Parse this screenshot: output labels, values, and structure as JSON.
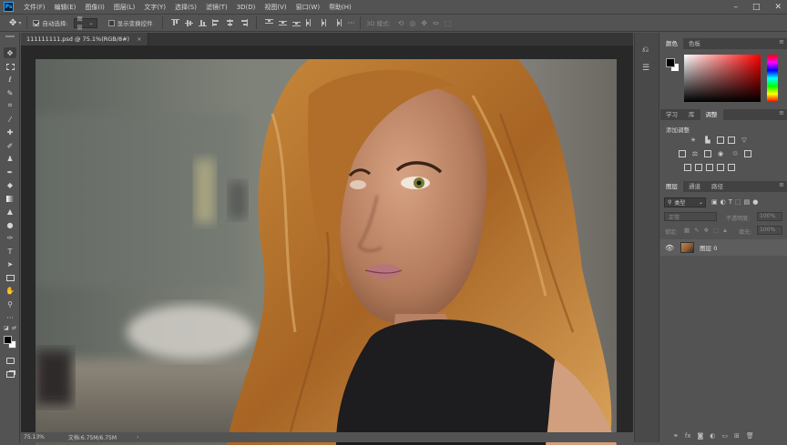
{
  "app": {
    "logo_text": "Ps"
  },
  "menubar": {
    "items": [
      "文件(F)",
      "编辑(E)",
      "图像(I)",
      "图层(L)",
      "文字(Y)",
      "选择(S)",
      "滤镜(T)",
      "3D(D)",
      "视图(V)",
      "窗口(W)",
      "帮助(H)"
    ]
  },
  "window_controls": {
    "minimize": "–",
    "maximize": "□",
    "close": "✕"
  },
  "options_bar": {
    "auto_select_label": "自动选择:",
    "auto_select_checked": true,
    "auto_select_target": "图层",
    "show_transform_label": "显示变换控件",
    "show_transform_checked": false,
    "mode_3d_label": "3D 模式:"
  },
  "document": {
    "tab_title": "111111111.psd @ 75.1%(RGB/8#)",
    "tab_close": "×"
  },
  "status": {
    "zoom": "75.13%",
    "doc_size": "文档:6.75M/6.75M",
    "arrow": "›"
  },
  "color_panel": {
    "tabs": [
      "颜色",
      "色板"
    ],
    "foreground": "#000000",
    "background": "#ffffff",
    "picker_hue": "#ff0000"
  },
  "adjustments_panel": {
    "tabs": [
      "学习",
      "库",
      "调整"
    ],
    "title": "添加调整"
  },
  "layers_panel": {
    "tabs": [
      "图层",
      "通道",
      "路径"
    ],
    "filter_label": "类型",
    "blend_mode": "正常",
    "opacity_label": "不透明度:",
    "opacity_value": "100%",
    "lock_label": "锁定:",
    "fill_label": "填充:",
    "fill_value": "100%",
    "layers": [
      {
        "name": "图层 0",
        "visible": true
      }
    ]
  },
  "colors": {
    "accent": "#31a8ff",
    "ui_bg": "#535353"
  }
}
